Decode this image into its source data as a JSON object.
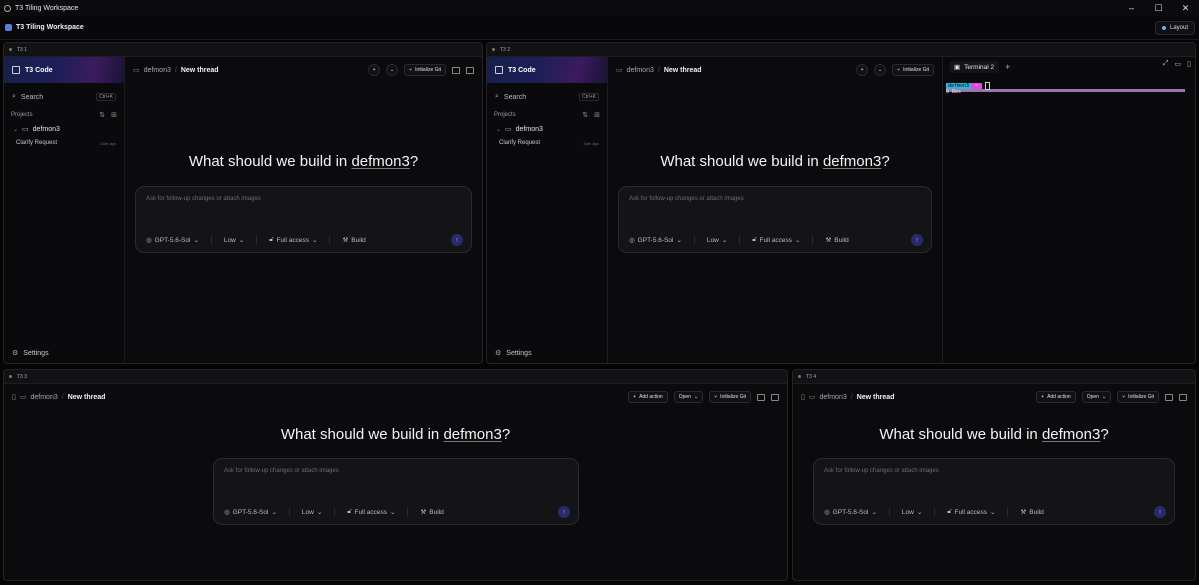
{
  "window": {
    "title": "T3 Tiling Workspace",
    "controls": [
      "–",
      "☐",
      "✕"
    ]
  },
  "appbar": {
    "title": "T3 Tiling Workspace",
    "layout_label": "Layout"
  },
  "common": {
    "brand": "T3 Code",
    "search_label": "Search",
    "search_shortcut": "Ctrl+K",
    "projects_label": "Projects",
    "project_name": "defmon3",
    "thread_title": "Clarify Request",
    "thread_age": "34m ago",
    "settings_label": "Settings",
    "crumb_project": "defmon3",
    "crumb_sep": "/",
    "crumb_thread": "New thread",
    "init_git": "Initialize Git",
    "add_action": "Add action",
    "open_label": "Open",
    "headline_prefix": "What should we build in ",
    "headline_project": "defmon3",
    "headline_suffix": "?",
    "composer_placeholder": "Ask for follow-up changes or attach images",
    "model": "GPT-5.6-Sol",
    "effort": "Low",
    "access": "Full access",
    "mode": "Build"
  },
  "panes": [
    {
      "label": "T3 1"
    },
    {
      "label": "T3 2"
    },
    {
      "label": "T3 3"
    },
    {
      "label": "T3 4"
    }
  ],
  "terminal": {
    "tab_label": "Terminal 2",
    "prompt_seg1": "defmon3",
    "prompt_seg2": "~",
    "line2": "0 Bes"
  }
}
